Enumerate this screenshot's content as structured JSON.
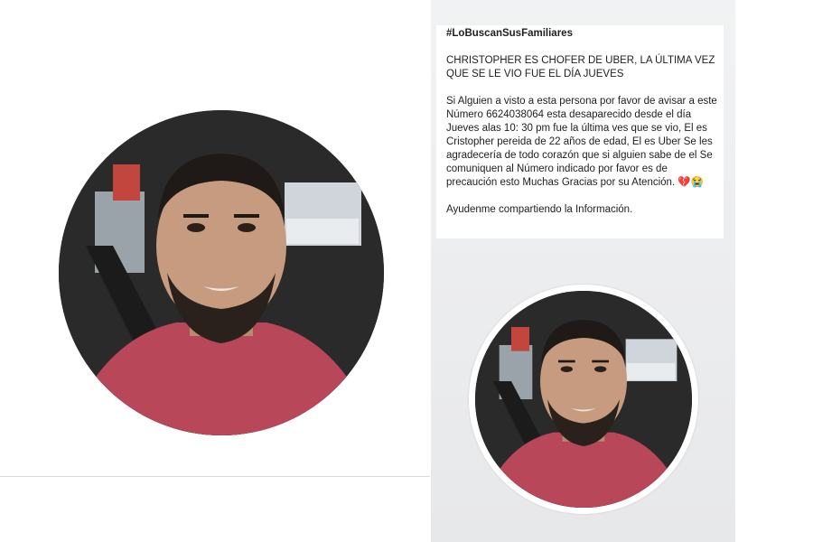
{
  "post": {
    "hashtag": "#LoBuscanSusFamiliares",
    "headline": "CHRISTOPHER ES CHOFER DE UBER, LA ÚLTIMA VEZ QUE SE LE VIO FUE EL DÍA JUEVES",
    "body": "Si Alguien a visto a esta persona por favor de avisar a este Número 6624038064 esta desaparecido desde el día Jueves alas 10: 30 pm fue la última ves que se vio, El es Cristopher pereida de 22 años de edad, El es Uber Se les agradecería de todo corazón que si alguien sabe de el Se comuniquen al Número indicado por favor es de precaución esto Muchas Gracias por su Atención. 💔😭",
    "footer": "Ayudenme compartiendo la Información."
  },
  "photos": {
    "left": {
      "icon": "profile-photo"
    },
    "right": {
      "icon": "profile-photo"
    }
  },
  "colors": {
    "shirt": "#b8475a",
    "skin": "#c79b7f",
    "hair": "#1f1a17",
    "car_interior": "#2b2b2b",
    "window": "#d9dde0",
    "panel_bg": "#eef0f1"
  }
}
